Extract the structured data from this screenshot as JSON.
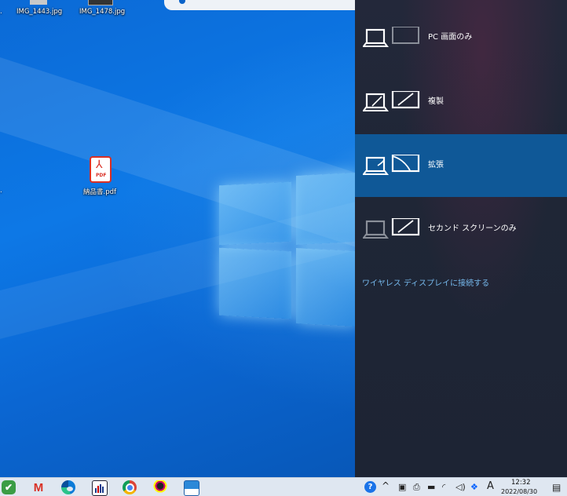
{
  "desktop": {
    "icons": [
      {
        "label": "IMG_1443.jpg"
      },
      {
        "label": "IMG_1478.jpg"
      },
      {
        "label": "納品書.pdf",
        "badge": "PDF"
      }
    ],
    "edge_fragments": [
      ".",
      "."
    ]
  },
  "project_panel": {
    "items": [
      {
        "label": "PC 画面のみ",
        "icon": "pc-screen-only-icon",
        "selected": false
      },
      {
        "label": "複製",
        "icon": "duplicate-icon",
        "selected": false
      },
      {
        "label": "拡張",
        "icon": "extend-icon",
        "selected": true
      },
      {
        "label": "セカンド スクリーンのみ",
        "icon": "second-screen-only-icon",
        "selected": false
      }
    ],
    "wireless_link": "ワイヤレス ディスプレイに接続する",
    "colors": {
      "background": "#1f2636",
      "selected": "#0f5897",
      "link": "#76b9ed"
    }
  },
  "taskbar": {
    "apps": [
      "app-green-icon",
      "gmail-icon",
      "edge-icon",
      "chart-app-icon",
      "chrome-icon",
      "character-app-icon",
      "photos-icon"
    ],
    "gmail_glyph": "M",
    "tray": {
      "help": "?",
      "chevron": "^",
      "ime": "A",
      "time": "12:32",
      "date": "2022/08/30"
    }
  }
}
